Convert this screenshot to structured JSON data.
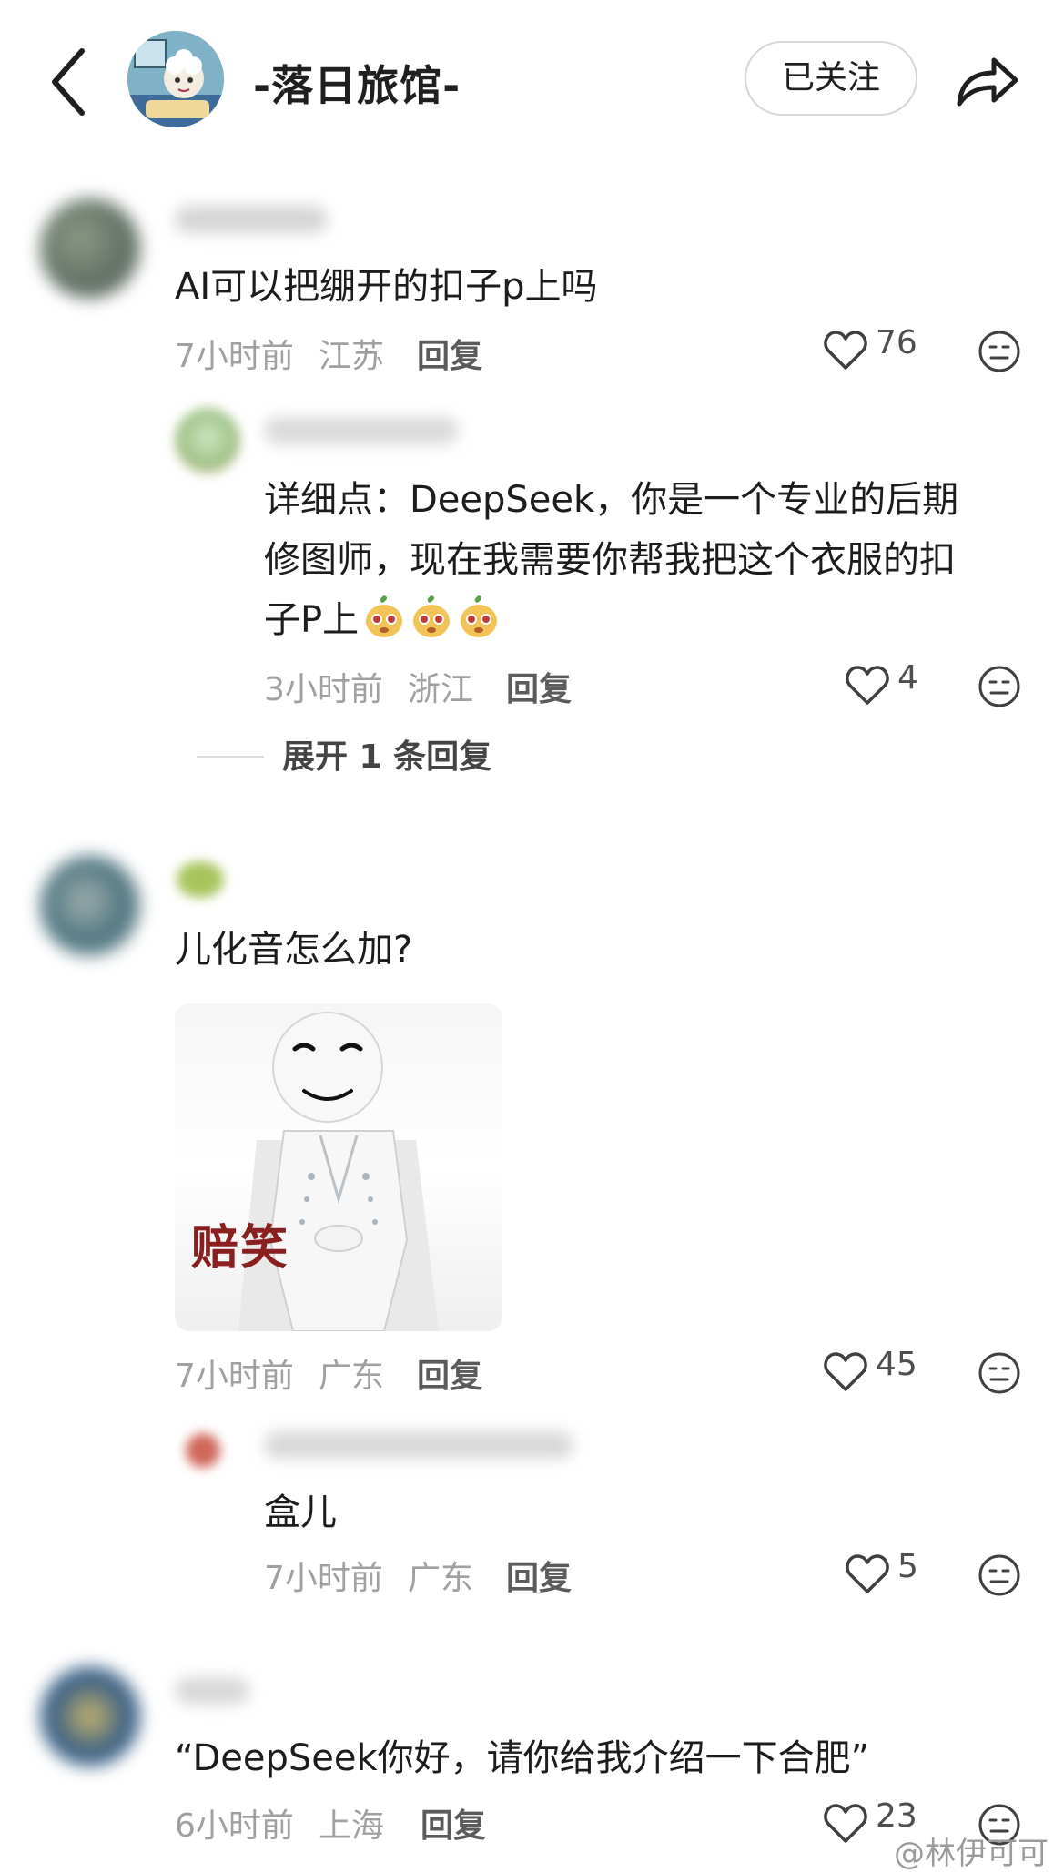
{
  "header": {
    "title": "-落日旅馆-",
    "follow_label": "已关注",
    "icons": [
      "chevron-left-icon",
      "share-arrow-icon"
    ]
  },
  "comments": [
    {
      "text": "AI可以把绷开的扣子p上吗",
      "time": "7小时前",
      "location": "江苏",
      "reply_label": "回复",
      "likes": "76",
      "replies": [
        {
          "text_lines": [
            "详细点：DeepSeek，你是一个专业的后期",
            "修图师，现在我需要你帮我把这个衣服的扣",
            "子P上"
          ],
          "time": "3小时前",
          "location": "浙江",
          "reply_label": "回复",
          "likes": "4"
        }
      ],
      "expand_label": "展开 1 条回复"
    },
    {
      "text": "儿化音怎么加?",
      "sticker_caption": "赔笑",
      "time": "7小时前",
      "location": "广东",
      "reply_label": "回复",
      "likes": "45",
      "replies": [
        {
          "text": "盒儿",
          "time": "7小时前",
          "location": "广东",
          "reply_label": "回复",
          "likes": "5"
        }
      ]
    },
    {
      "text": "“DeepSeek你好，请你给我介绍一下合肥”",
      "time": "6小时前",
      "location": "上海",
      "reply_label": "回复",
      "likes": "23"
    }
  ],
  "watermark": "@林伊可可",
  "colors": {
    "meta": "#a0a0a0",
    "sticker_caption": "#8a1f1f"
  }
}
